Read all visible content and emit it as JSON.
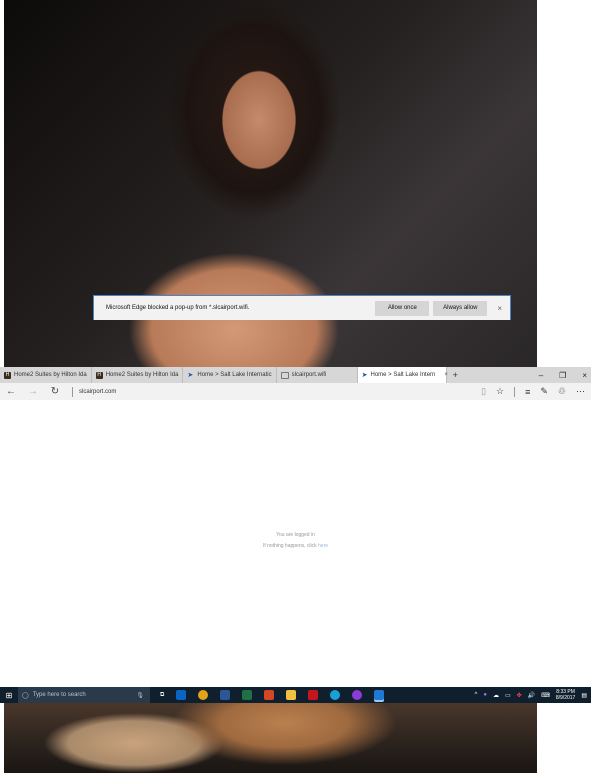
{
  "browser": {
    "tabs": [
      {
        "title": "Home2 Suites by Hilton Ida",
        "favicon": "hilton-icon",
        "active": false
      },
      {
        "title": "Home2 Suites by Hilton Ida",
        "favicon": "hilton-icon",
        "active": false
      },
      {
        "title": "Home > Salt Lake Internatic",
        "favicon": "slc-airport-icon",
        "active": false
      },
      {
        "title": "slcairport.wifi",
        "favicon": "page-icon",
        "active": false
      },
      {
        "title": "Home > Salt Lake Intern",
        "favicon": "slc-airport-icon",
        "active": true
      }
    ],
    "new_tab_glyph": "+",
    "close_glyph": "×",
    "window_controls": {
      "minimize": "–",
      "restore": "❐",
      "close": "×"
    },
    "address": "slcairport.com"
  },
  "page": {
    "logged_in_text": "You are logged in",
    "nothing_happens_text": "If nothing happens, click",
    "here_link": "here"
  },
  "popup_bar": {
    "message": "Microsoft Edge blocked a pop-up from *.slcairport.wifi.",
    "allow_once": "Allow once",
    "always_allow": "Always allow",
    "close": "×"
  },
  "taskbar": {
    "search_placeholder": "Type here to search",
    "time": "8:33 PM",
    "date": "8/9/2017"
  },
  "colors": {
    "popup_border": "#4b84c4",
    "taskbar_bg": "#101f2d",
    "tabbar_bg": "#d7d7d7"
  }
}
